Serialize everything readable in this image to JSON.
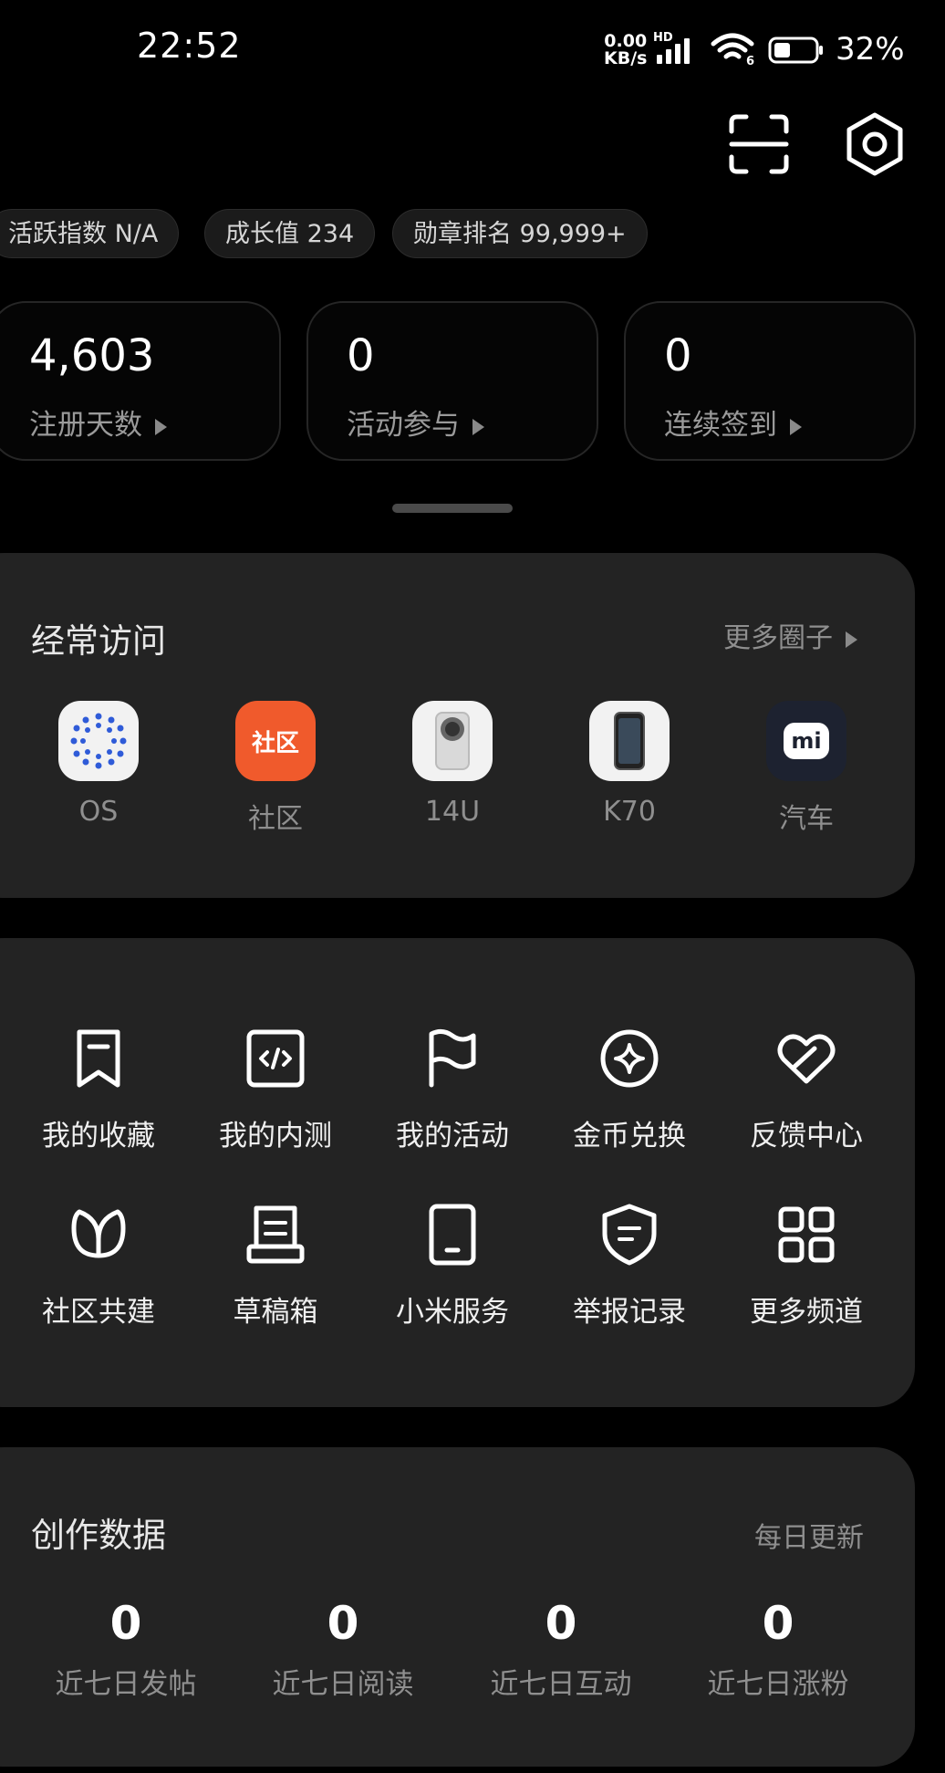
{
  "status_bar": {
    "time": "22:52",
    "net_speed_value": "0.00",
    "net_speed_unit": "KB/s",
    "hd": "HD",
    "wifi_tag": "6",
    "battery": "32%"
  },
  "badges": [
    {
      "label": "活跃指数 N/A"
    },
    {
      "label": "成长值 234"
    },
    {
      "label": "勋章排名 99,999+"
    }
  ],
  "stats": [
    {
      "value": "4,603",
      "label": "注册天数"
    },
    {
      "value": "0",
      "label": "活动参与"
    },
    {
      "value": "0",
      "label": "连续签到"
    }
  ],
  "frequent": {
    "title": "经常访问",
    "more_label": "更多圈子",
    "apps": [
      {
        "label": "OS",
        "icon": "os-dots-icon"
      },
      {
        "label": "社区",
        "icon_text": "社区",
        "icon": "community-icon",
        "color": "#f05a2c"
      },
      {
        "label": "14U",
        "icon": "phone-14u-icon"
      },
      {
        "label": "K70",
        "icon": "phone-k70-icon"
      },
      {
        "label": "汽车",
        "icon_text": "mi",
        "icon": "mi-logo-icon"
      }
    ]
  },
  "tools": {
    "items": [
      {
        "label": "我的收藏",
        "icon": "bookmark-icon"
      },
      {
        "label": "我的内测",
        "icon": "code-icon"
      },
      {
        "label": "我的活动",
        "icon": "flag-icon"
      },
      {
        "label": "金币兑换",
        "icon": "sparkle-icon"
      },
      {
        "label": "反馈中心",
        "icon": "heart-icon"
      },
      {
        "label": "社区共建",
        "icon": "leaf-icon"
      },
      {
        "label": "草稿箱",
        "icon": "draft-icon"
      },
      {
        "label": "小米服务",
        "icon": "tablet-icon"
      },
      {
        "label": "举报记录",
        "icon": "shield-icon"
      },
      {
        "label": "更多频道",
        "icon": "grid-icon"
      }
    ]
  },
  "creation": {
    "title": "创作数据",
    "update_label": "每日更新",
    "metrics": [
      {
        "value": "0",
        "label": "近七日发帖"
      },
      {
        "value": "0",
        "label": "近七日阅读"
      },
      {
        "value": "0",
        "label": "近七日互动"
      },
      {
        "value": "0",
        "label": "近七日涨粉"
      }
    ]
  }
}
